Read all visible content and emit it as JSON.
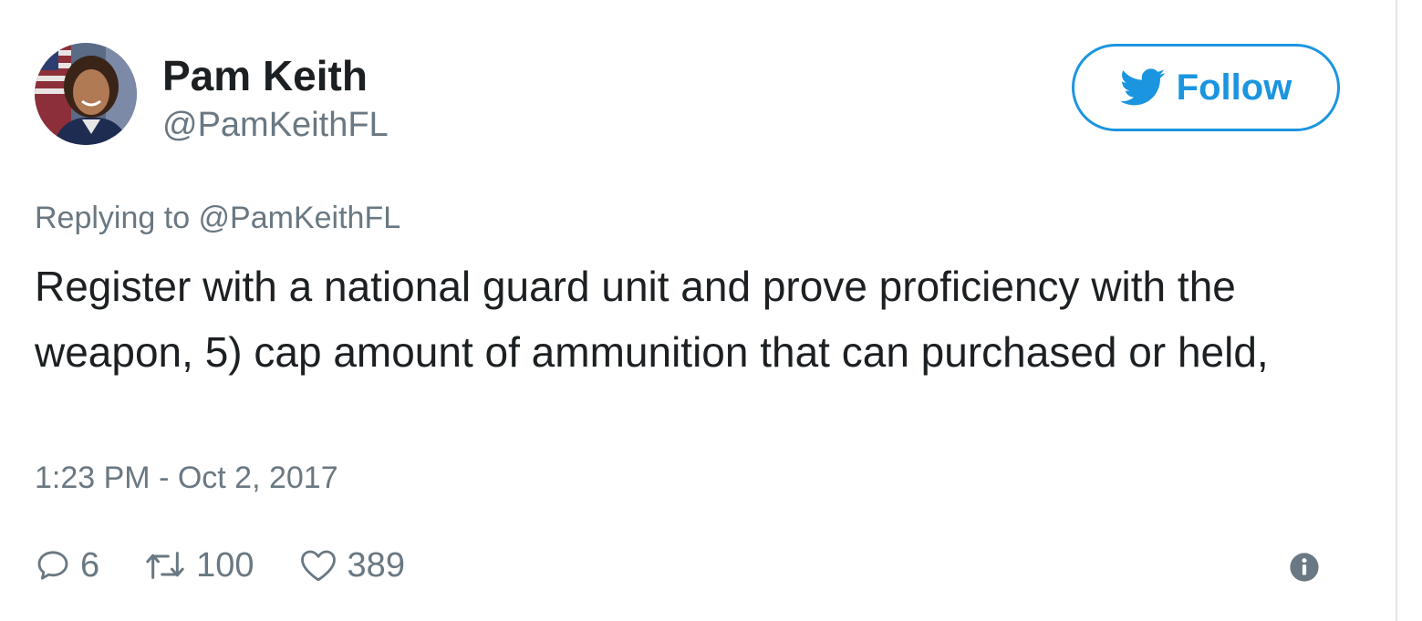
{
  "user": {
    "display_name": "Pam Keith",
    "handle": "@PamKeithFL"
  },
  "follow_button": {
    "label": "Follow",
    "icon": "twitter-bird-icon"
  },
  "reply_context": {
    "prefix": "Replying to ",
    "handle": "@PamKeithFL"
  },
  "tweet": {
    "text": "Register with a national guard unit and prove proficiency with the weapon, 5) cap amount of ammunition that can purchased or held,",
    "timestamp": "1:23 PM - Oct 2, 2017"
  },
  "actions": {
    "reply": {
      "icon": "reply-icon",
      "count": "6"
    },
    "retweet": {
      "icon": "retweet-icon",
      "count": "100"
    },
    "like": {
      "icon": "heart-icon",
      "count": "389"
    },
    "info": {
      "icon": "info-icon"
    }
  },
  "colors": {
    "accent": "#1b95e0",
    "text": "#1c2022",
    "muted": "#697882"
  }
}
